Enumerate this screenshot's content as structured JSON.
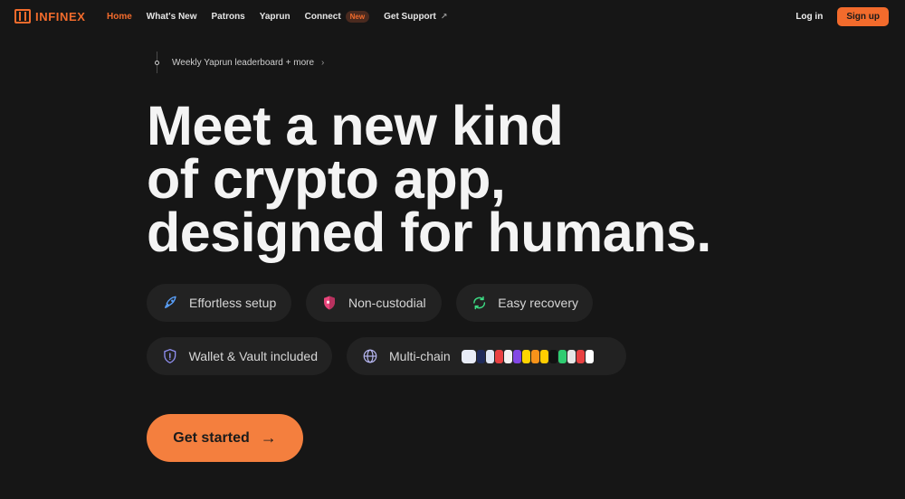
{
  "brand": {
    "name": "INFINEX",
    "accent": "#f26b2c"
  },
  "nav": {
    "items": [
      {
        "label": "Home"
      },
      {
        "label": "What's New"
      },
      {
        "label": "Patrons"
      },
      {
        "label": "Yaprun"
      },
      {
        "label": "Connect",
        "badge": "New"
      },
      {
        "label": "Get Support"
      }
    ],
    "login_label": "Log in",
    "signup_label": "Sign up"
  },
  "announcement": {
    "text": "Weekly Yaprun leaderboard + more"
  },
  "hero": {
    "lines": [
      "Meet a new kind",
      "of crypto app,",
      "designed for humans."
    ]
  },
  "features": [
    {
      "label": "Effortless setup",
      "icon": "rocket-icon"
    },
    {
      "label": "Non-custodial",
      "icon": "shield-icon"
    },
    {
      "label": "Easy recovery",
      "icon": "recovery-icon"
    },
    {
      "label": "Wallet & Vault included",
      "icon": "vault-shield-icon"
    },
    {
      "label": "Multi-chain",
      "icon": "globe-icon"
    }
  ],
  "chains": [
    {
      "color": "#e8ecf7"
    },
    {
      "color": "#1e2a5a"
    },
    {
      "color": "#dfe7f5"
    },
    {
      "color": "#e84142"
    },
    {
      "color": "#f2f2f2"
    },
    {
      "color": "#8247e5"
    },
    {
      "color": "#ffd400"
    },
    {
      "color": "#f7931a"
    },
    {
      "color": "#ffcd00"
    },
    {
      "color": "#111111"
    },
    {
      "color": "#2ecc71"
    },
    {
      "color": "#e6e6e6"
    },
    {
      "color": "#e84142"
    },
    {
      "color": "#ffffff"
    }
  ],
  "cta": {
    "label": "Get started"
  }
}
